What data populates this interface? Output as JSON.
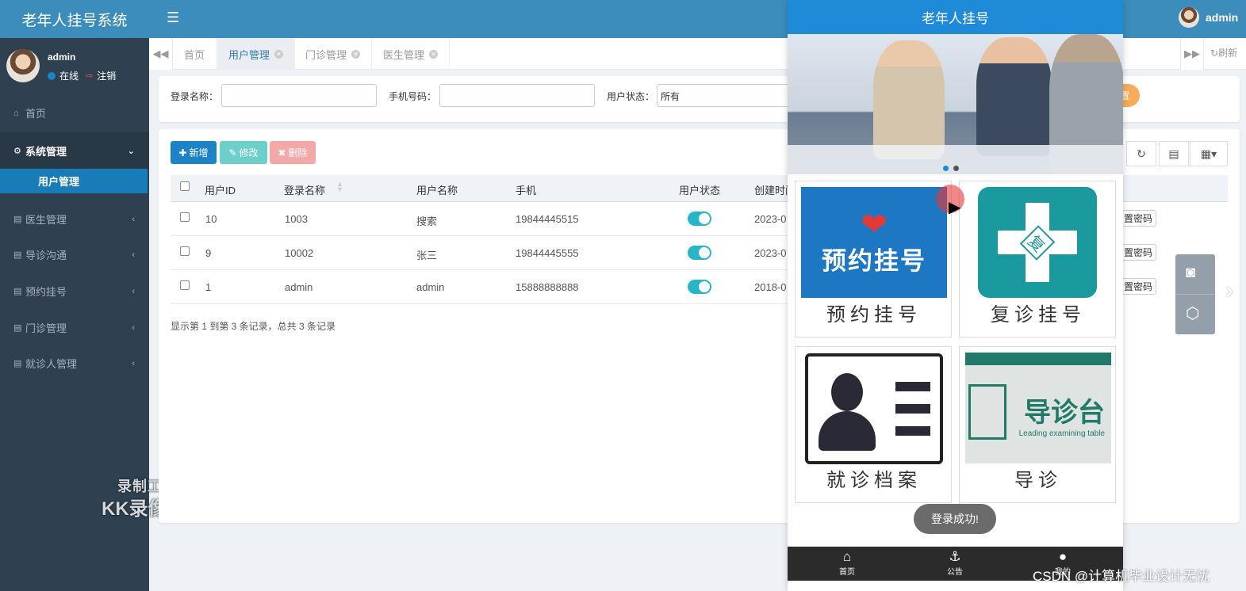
{
  "app": {
    "brand": "老年人挂号系统"
  },
  "sidebar": {
    "username": "admin",
    "status_online": "在线",
    "logout": "注销",
    "items": [
      {
        "label": "首页",
        "icon": "home-icon"
      },
      {
        "label": "系统管理",
        "icon": "gear-icon"
      },
      {
        "label": "用户管理"
      },
      {
        "label": "医生管理",
        "icon": "book-icon"
      },
      {
        "label": "导诊沟通",
        "icon": "book-icon"
      },
      {
        "label": "预约挂号",
        "icon": "book-icon"
      },
      {
        "label": "门诊管理",
        "icon": "book-icon"
      },
      {
        "label": "就诊人管理",
        "icon": "book-icon"
      }
    ],
    "watermark_line1": "录制工具",
    "watermark_line2": "KK录像机"
  },
  "header": {
    "username": "admin",
    "refresh": "刷新"
  },
  "tabs": [
    {
      "label": "首页"
    },
    {
      "label": "用户管理",
      "active": true
    },
    {
      "label": "门诊管理"
    },
    {
      "label": "医生管理"
    }
  ],
  "search": {
    "login_name_label": "登录名称：",
    "login_name_value": "",
    "phone_label": "手机号码：",
    "phone_value": "",
    "status_label": "用户状态：",
    "status_value": "所有",
    "action_partial": "置"
  },
  "toolbar": {
    "add": "新增",
    "edit": "修改",
    "delete": "删除"
  },
  "table": {
    "headers": [
      "用户ID",
      "登录名称",
      "用户名称",
      "手机",
      "用户状态",
      "创建时间"
    ],
    "rows": [
      {
        "id": "10",
        "login": "1003",
        "name": "搜索",
        "phone": "19844445515",
        "created": "2023-0",
        "reset": "置密码"
      },
      {
        "id": "9",
        "login": "10002",
        "name": "张三",
        "phone": "19844445555",
        "created": "2023-0",
        "reset": "置密码"
      },
      {
        "id": "1",
        "login": "admin",
        "name": "admin",
        "phone": "15888888888",
        "created": "2018-0",
        "reset": "置密码"
      }
    ],
    "footer": "显示第 1 到第 3 条记录，总共 3 条记录"
  },
  "mobile": {
    "title": "老年人挂号",
    "cards": [
      {
        "label": "预约挂号",
        "image_text": "预约挂号"
      },
      {
        "label": "复诊挂号",
        "image_text": "复"
      },
      {
        "label": "就诊档案"
      },
      {
        "label": "导诊",
        "image_text": "导诊台",
        "image_subtext": "Leading examining table"
      }
    ],
    "toast": "登录成功!",
    "nav": [
      {
        "label": "首页",
        "icon": "home-icon"
      },
      {
        "label": "公告",
        "icon": "anchor-icon"
      },
      {
        "label": "我的",
        "icon": "user-icon"
      }
    ]
  },
  "csdn_watermark": "CSDN @计算机毕业设计无忧",
  "colors": {
    "header": "#3c8dbc",
    "sidebar": "#2f4050",
    "active_nav": "#1a7bb9",
    "mobile_title": "#1f8ad8",
    "toggle_on": "#27b6c9"
  }
}
